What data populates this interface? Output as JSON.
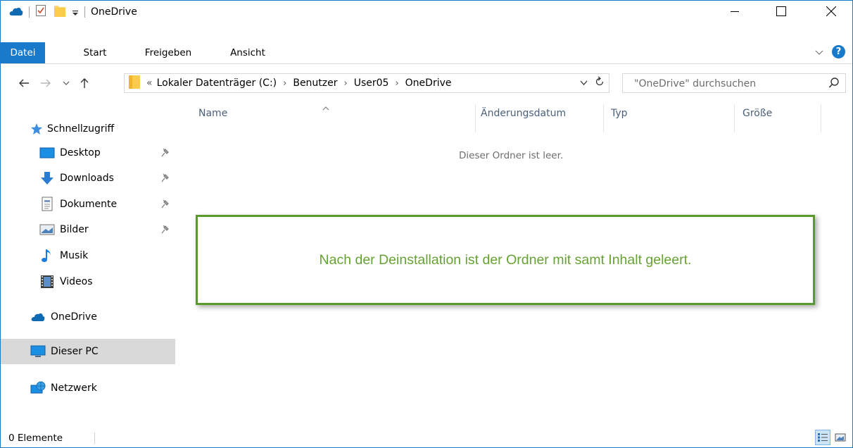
{
  "window": {
    "title": "OneDrive",
    "accent": "#1979ca"
  },
  "ribbon": {
    "tabs": [
      {
        "label": "Datei"
      },
      {
        "label": "Start"
      },
      {
        "label": "Freigeben"
      },
      {
        "label": "Ansicht"
      }
    ]
  },
  "navbar": {
    "breadcrumb_overflow": "«",
    "breadcrumbs": [
      "Lokaler Datenträger (C:)",
      "Benutzer",
      "User05",
      "OneDrive"
    ],
    "search_placeholder": "\"OneDrive\" durchsuchen"
  },
  "navpane": {
    "quick_access": "Schnellzugriff",
    "pinned": [
      {
        "label": "Desktop",
        "icon": "desktop-icon"
      },
      {
        "label": "Downloads",
        "icon": "downloads-icon"
      },
      {
        "label": "Dokumente",
        "icon": "documents-icon"
      },
      {
        "label": "Bilder",
        "icon": "pictures-icon"
      }
    ],
    "music": "Musik",
    "videos": "Videos",
    "onedrive": "OneDrive",
    "this_pc": "Dieser PC",
    "network": "Netzwerk"
  },
  "content": {
    "columns": [
      "Name",
      "Änderungsdatum",
      "Typ",
      "Größe"
    ],
    "empty_message": "Dieser Ordner ist leer."
  },
  "callout": {
    "text": "Nach der Deinstallation ist der Ordner mit samt Inhalt geleert.",
    "color": "#66a233"
  },
  "statusbar": {
    "item_count": "0 Elemente"
  }
}
